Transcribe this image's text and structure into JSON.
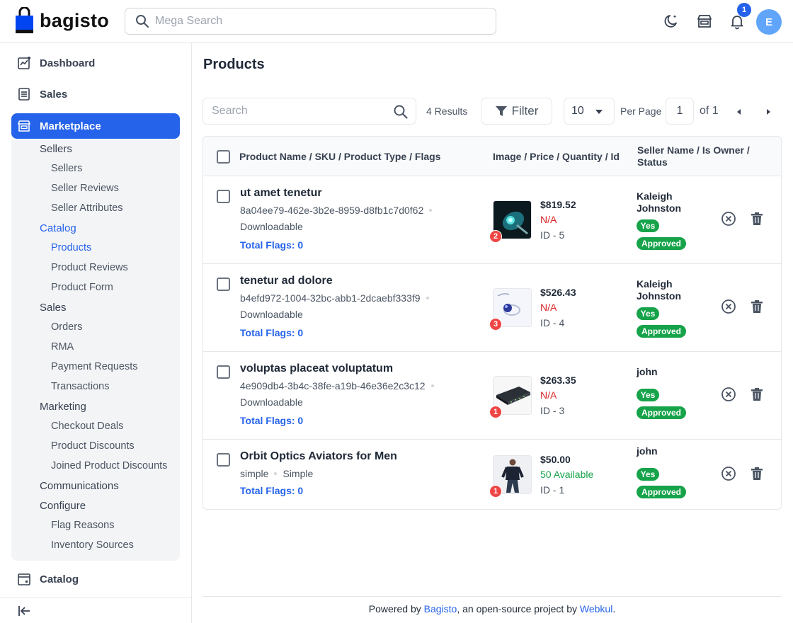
{
  "header": {
    "logo_text": "bagisto",
    "search_placeholder": "Mega Search",
    "notification_count": "1",
    "avatar_initial": "E",
    "icons": [
      "moon-icon",
      "store-icon",
      "bell-icon"
    ]
  },
  "sidebar": {
    "items": [
      {
        "label": "Dashboard",
        "icon": "dashboard-icon"
      },
      {
        "label": "Sales",
        "icon": "sales-icon"
      },
      {
        "label": "Marketplace",
        "icon": "store-icon",
        "active": true
      },
      {
        "label": "Catalog",
        "icon": "catalog-icon"
      }
    ],
    "marketplace": {
      "sellers": "Sellers",
      "sellers_items": [
        "Sellers",
        "Seller Reviews",
        "Seller Attributes"
      ],
      "catalog": "Catalog",
      "catalog_items": [
        "Products",
        "Product Reviews",
        "Product Form"
      ],
      "sales": "Sales",
      "sales_items": [
        "Orders",
        "RMA",
        "Payment Requests",
        "Transactions"
      ],
      "marketing": "Marketing",
      "marketing_items": [
        "Checkout Deals",
        "Product Discounts",
        "Joined Product Discounts"
      ],
      "communications": "Communications",
      "configure": "Configure",
      "configure_items": [
        "Flag Reasons",
        "Inventory Sources"
      ]
    }
  },
  "main": {
    "title": "Products",
    "search_placeholder": "Search",
    "results": "4 Results",
    "filter_label": "Filter",
    "per_page_value": "10",
    "per_page_label": "Per Page",
    "page_number": "1",
    "of_pages": "of 1"
  },
  "table": {
    "headers": {
      "col1": "Product Name / SKU / Product Type / Flags",
      "col2": "Image / Price / Quantity / Id",
      "col3_line1": "Seller Name / Is Owner /",
      "col3_line2": "Status"
    },
    "rows": [
      {
        "name": "ut amet tenetur",
        "sku": "8a04ee79-462e-3b2e-8959-d8fb1c7d0f62",
        "type": "Downloadable",
        "flags": "Total Flags: 0",
        "image_count": "2",
        "price": "$819.52",
        "quantity": "N/A",
        "id": "ID - 5",
        "seller_line1": "Kaleigh",
        "seller_line2": "Johnston",
        "owner": "Yes",
        "status": "Approved"
      },
      {
        "name": "tenetur ad dolore",
        "sku": "b4efd972-1004-32bc-abb1-2dcaebf333f9",
        "type": "Downloadable",
        "flags": "Total Flags: 0",
        "image_count": "3",
        "price": "$526.43",
        "quantity": "N/A",
        "id": "ID - 4",
        "seller_line1": "Kaleigh",
        "seller_line2": "Johnston",
        "owner": "Yes",
        "status": "Approved"
      },
      {
        "name": "voluptas placeat voluptatum",
        "sku": "4e909db4-3b4c-38fe-a19b-46e36e2c3c12",
        "type": "Downloadable",
        "flags": "Total Flags: 0",
        "image_count": "1",
        "price": "$263.35",
        "quantity": "N/A",
        "id": "ID - 3",
        "seller_line1": "john",
        "seller_line2": "",
        "owner": "Yes",
        "status": "Approved"
      },
      {
        "name": "Orbit Optics Aviators for Men",
        "sku": "simple",
        "type_inline": "Simple",
        "flags": "Total Flags: 0",
        "image_count": "1",
        "price": "$50.00",
        "quantity": "50 Available",
        "id": "ID - 1",
        "seller_line1": "john",
        "seller_line2": "",
        "owner": "Yes",
        "status": "Approved"
      }
    ]
  },
  "footer": {
    "prefix": "Powered by ",
    "link1": "Bagisto",
    "middle": ", an open-source project by ",
    "link2": "Webkul",
    "suffix": "."
  }
}
